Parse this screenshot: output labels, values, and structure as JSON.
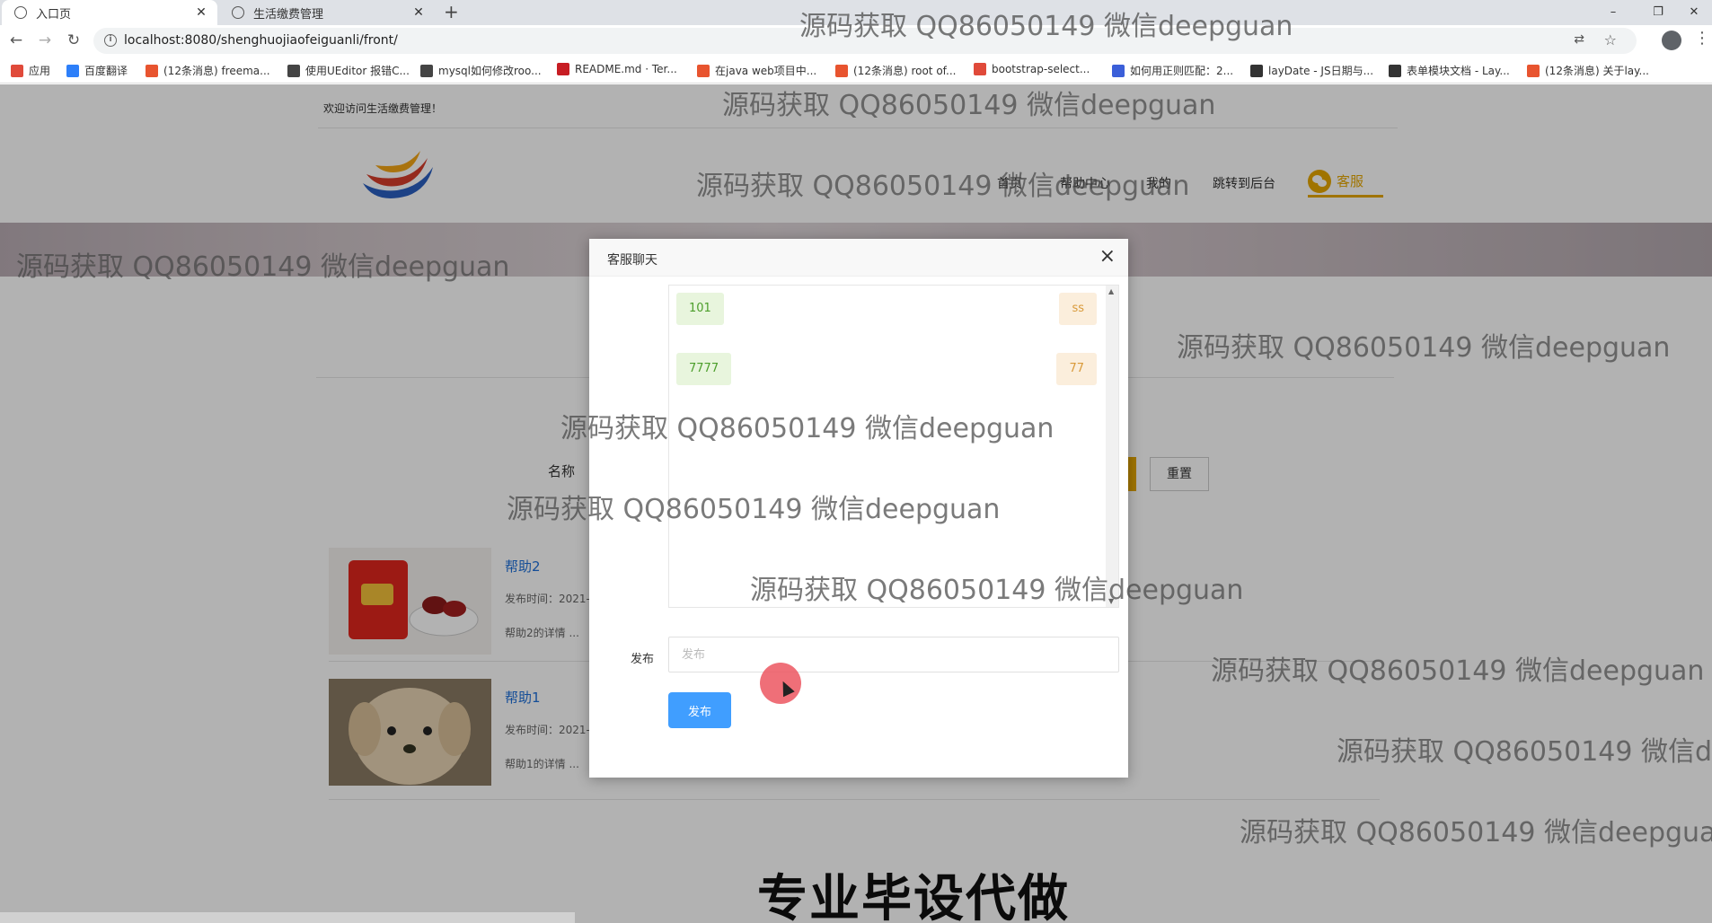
{
  "browser": {
    "tabs": [
      {
        "label": "入口页",
        "active": true
      },
      {
        "label": "生活缴费管理",
        "active": false
      }
    ],
    "new_tab": "+",
    "window_controls": {
      "minimize": "–",
      "restore": "❐",
      "close": "✕"
    },
    "url": "localhost:8080/shenghuojiaofeiguanli/front/",
    "nav": {
      "back": "←",
      "forward": "→",
      "reload": "↻"
    },
    "bookmarks": [
      {
        "label": "应用",
        "color": "#e04a3a"
      },
      {
        "label": "百度翻译",
        "color": "#2d7ff9"
      },
      {
        "label": "(12条消息) freema...",
        "color": "#e8542f"
      },
      {
        "label": "使用UEditor 报错C...",
        "color": "#444444"
      },
      {
        "label": "mysql如何修改roo...",
        "color": "#444444"
      },
      {
        "label": "README.md · Ter...",
        "color": "#c71d23"
      },
      {
        "label": "在java web项目中...",
        "color": "#e8542f"
      },
      {
        "label": "(12条消息) root of...",
        "color": "#e8542f"
      },
      {
        "label": "bootstrap-select...",
        "color": "#e04a3a"
      },
      {
        "label": "如何用正则匹配：2...",
        "color": "#3b5fd9"
      },
      {
        "label": "layDate - JS日期与...",
        "color": "#333333"
      },
      {
        "label": "表单模块文档 - Lay...",
        "color": "#333333"
      },
      {
        "label": "(12条消息) 关于lay...",
        "color": "#e8542f"
      }
    ]
  },
  "site": {
    "welcome": "欢迎访问生活缴费管理！",
    "nav": [
      "首页",
      "帮助中心",
      "我的",
      "跳转到后台"
    ],
    "kefu": "客服",
    "search_label": "名称",
    "reset": "重置",
    "items": [
      {
        "title": "帮助2",
        "time": "发布时间：2021-",
        "desc": "帮助2的详情 ..."
      },
      {
        "title": "帮助1",
        "time": "发布时间：2021-",
        "desc": "帮助1的详情 ..."
      }
    ],
    "promo": "专业毕设代做"
  },
  "modal": {
    "title": "客服聊天",
    "close": "×",
    "messages": [
      {
        "left": "101",
        "right": "ss"
      },
      {
        "left": "7777",
        "right": "77"
      }
    ],
    "post_label": "发布",
    "post_placeholder": "发布",
    "post_button": "发布"
  },
  "watermark": "源码获取 QQ86050149 微信deepguan",
  "colors": {
    "accent": "#e6a700",
    "primary_button": "#409eff",
    "link": "#1e6fd9"
  }
}
